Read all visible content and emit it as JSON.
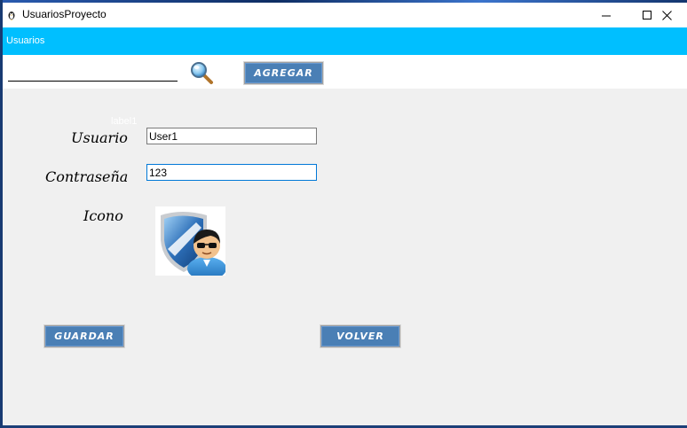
{
  "window": {
    "title": "UsuariosProyecto",
    "app_icon": "app-icon",
    "controls": [
      "minimize-icon",
      "maximize-icon",
      "close-icon"
    ]
  },
  "menu": {
    "items": [
      {
        "label": "Usuarios"
      }
    ]
  },
  "toolbar": {
    "search_value": "",
    "search_icon": "magnifier-icon",
    "add_label": "Agregar"
  },
  "form": {
    "hidden_label": "label1",
    "user_label": "Usuario",
    "user_value": "User1",
    "password_label": "Contraseña",
    "password_value": "123",
    "icon_label": "Icono",
    "avatar_icon": "user-shield-avatar-icon"
  },
  "actions": {
    "save_label": "Guardar",
    "back_label": "Volver"
  },
  "colors": {
    "menubar": "#00bfff",
    "button": "#4a7fb5",
    "window_bg": "#f0f0f0"
  }
}
